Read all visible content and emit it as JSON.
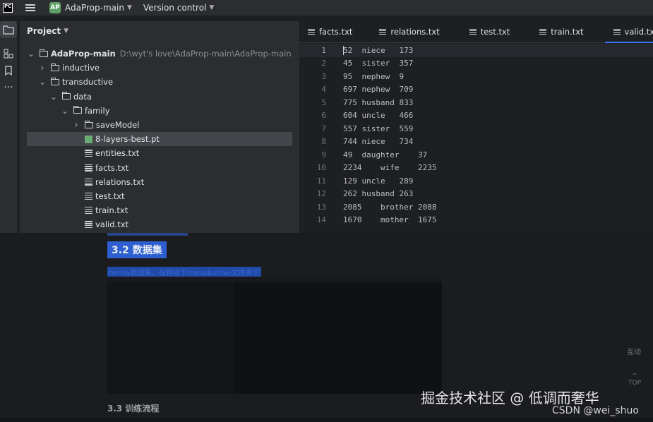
{
  "topbar": {
    "logo": "PC",
    "project_badge": "AP",
    "project_name": "AdaProp-main",
    "vcs_label": "Version control"
  },
  "stripe": {
    "icons": [
      "folder-icon",
      "structure-icon",
      "bookmark-icon",
      "more-icon"
    ],
    "more_glyph": "···"
  },
  "project_panel": {
    "title": "Project",
    "tree": [
      {
        "label": "AdaProp-main",
        "path": "D:\\wyt's love\\AdaProp-main\\AdaProp-main",
        "type": "folder",
        "expanded": true,
        "depth": 0
      },
      {
        "label": "inductive",
        "type": "folder",
        "expanded": false,
        "depth": 1
      },
      {
        "label": "transductive",
        "type": "folder",
        "expanded": true,
        "depth": 1
      },
      {
        "label": "data",
        "type": "folder",
        "expanded": true,
        "depth": 2
      },
      {
        "label": "family",
        "type": "folder",
        "expanded": true,
        "depth": 3
      },
      {
        "label": "saveModel",
        "type": "folder",
        "expanded": false,
        "depth": 4
      },
      {
        "label": "8-layers-best.pt",
        "type": "pt",
        "depth": 4,
        "selected": true
      },
      {
        "label": "entities.txt",
        "type": "txt",
        "depth": 4
      },
      {
        "label": "facts.txt",
        "type": "txt",
        "depth": 4
      },
      {
        "label": "relations.txt",
        "type": "txt",
        "depth": 4
      },
      {
        "label": "test.txt",
        "type": "txt",
        "depth": 4
      },
      {
        "label": "train.txt",
        "type": "txt",
        "depth": 4
      },
      {
        "label": "valid.txt",
        "type": "txt",
        "depth": 4
      }
    ]
  },
  "editor": {
    "tabs": [
      {
        "label": "facts.txt",
        "active": false
      },
      {
        "label": "relations.txt",
        "active": false
      },
      {
        "label": "test.txt",
        "active": false
      },
      {
        "label": "train.txt",
        "active": false
      },
      {
        "label": "valid.txt",
        "active": true
      }
    ],
    "close_glyph": "×",
    "lines": [
      {
        "n": "1",
        "text": "52  niece   173"
      },
      {
        "n": "2",
        "text": "45  sister  357"
      },
      {
        "n": "3",
        "text": "95  nephew  9"
      },
      {
        "n": "4",
        "text": "697 nephew  709"
      },
      {
        "n": "5",
        "text": "775 husband 833"
      },
      {
        "n": "6",
        "text": "604 uncle   466"
      },
      {
        "n": "7",
        "text": "557 sister  559"
      },
      {
        "n": "8",
        "text": "744 niece   734"
      },
      {
        "n": "9",
        "text": "49  daughter    37"
      },
      {
        "n": "10",
        "text": "2234    wife    2235"
      },
      {
        "n": "11",
        "text": "129 uncle   289"
      },
      {
        "n": "12",
        "text": "262 husband 263"
      },
      {
        "n": "13",
        "text": "2085    brother 2088"
      },
      {
        "n": "14",
        "text": "1670    mother  1675"
      }
    ]
  },
  "page_below": {
    "section_title": "3.2 数据集",
    "section_text": "family数据集，在路径下transductive文件夹下",
    "subsection_title": "3.3 训练流程",
    "side_label": "互动",
    "top_label": "TOP",
    "top_arrow": "^",
    "watermark": "掘金技术社区 @ 低调而奢华",
    "csdn": "CSDN @wei_shuo"
  }
}
